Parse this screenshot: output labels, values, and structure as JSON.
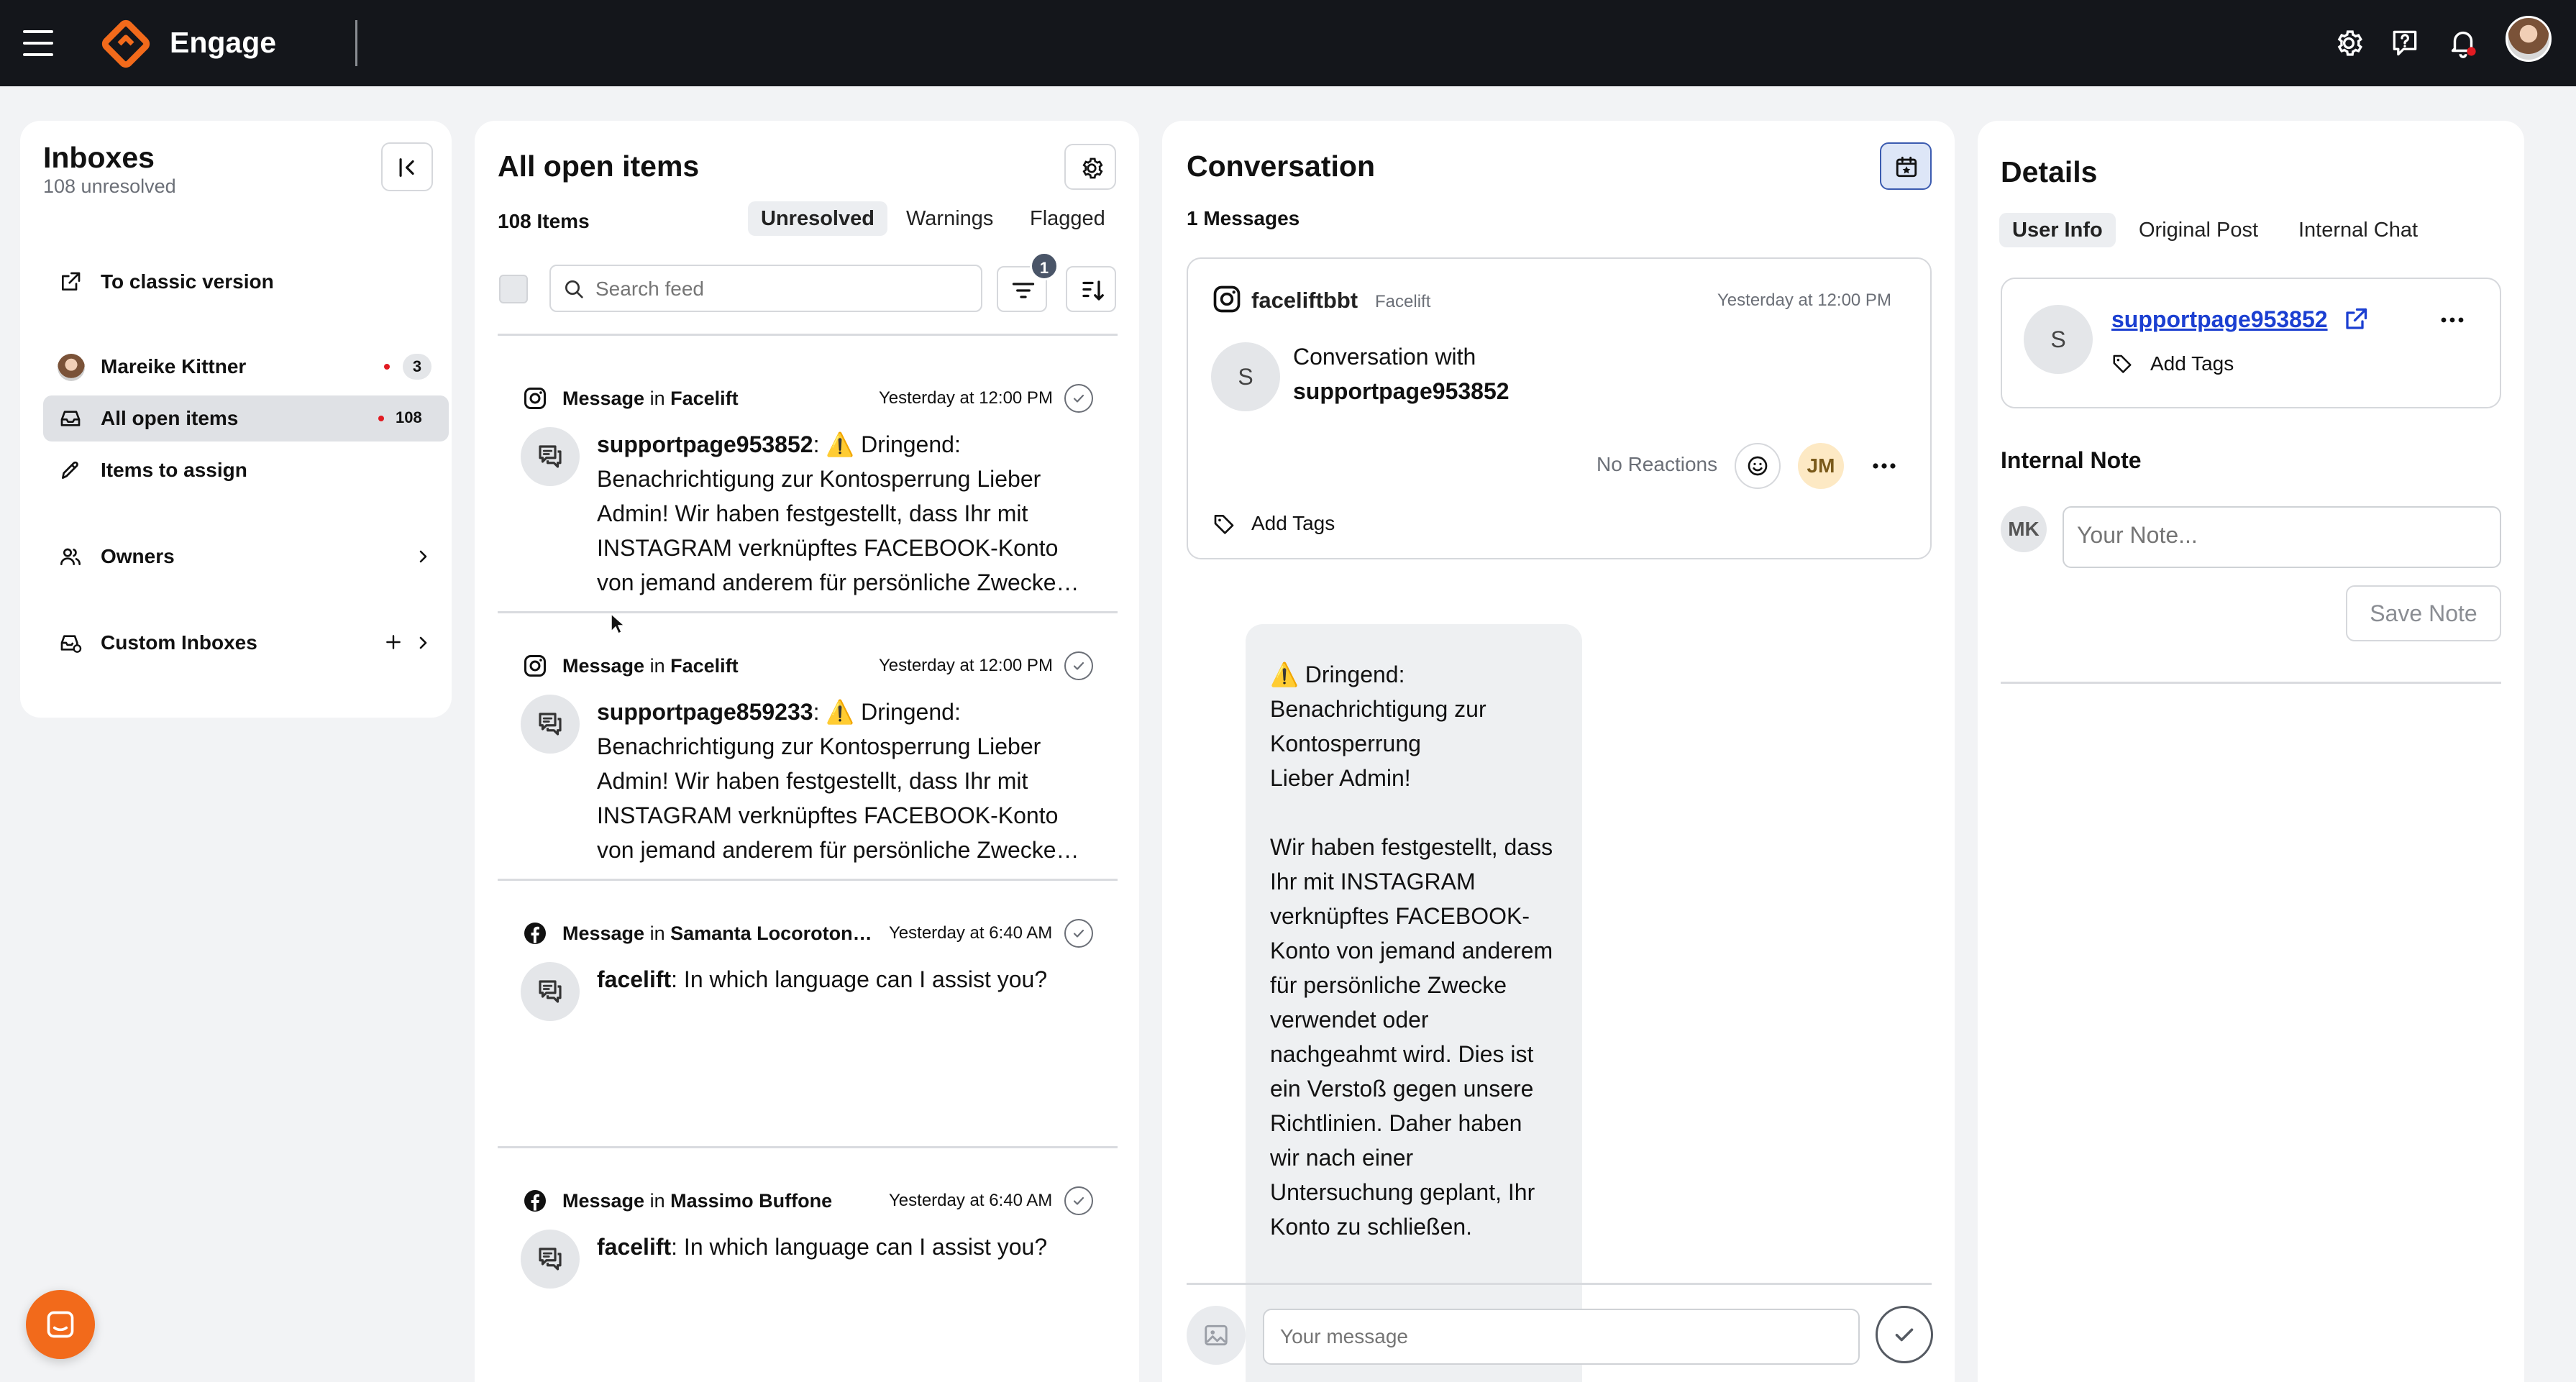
{
  "app": {
    "name": "Engage"
  },
  "sidebar": {
    "title": "Inboxes",
    "subtitle": "108 unresolved",
    "classic_link": "To classic version",
    "user": {
      "name": "Mareike Kittner",
      "count": "3"
    },
    "all_open": {
      "label": "All open items",
      "count": "108"
    },
    "assign": {
      "label": "Items to assign"
    },
    "owners": {
      "label": "Owners"
    },
    "custom": {
      "label": "Custom Inboxes"
    }
  },
  "feed": {
    "title": "All open items",
    "count_label": "108 Items",
    "tabs": [
      "Unresolved",
      "Warnings",
      "Flagged"
    ],
    "search_placeholder": "Search feed",
    "filter_badge": "1",
    "items": [
      {
        "kind": "Message",
        "in": "in",
        "source": "Facelift",
        "time": "Yesterday at 12:00 PM",
        "author": "supportpage953852",
        "text": ": ⚠️ Dringend: Benachrichtigung zur Kontosperrung Lieber Admin! Wir haben festgestellt, dass Ihr mit INSTAGRAM verknüpftes FACEBOOK-Konto von jemand anderem für persönliche Zwecke verwendet oder nachgeahmt wird."
      },
      {
        "kind": "Message",
        "in": "in",
        "source": "Facelift",
        "time": "Yesterday at 12:00 PM",
        "author": "supportpage859233",
        "text": ": ⚠️ Dringend: Benachrichtigung zur Kontosperrung Lieber Admin! Wir haben festgestellt, dass Ihr mit INSTAGRAM verknüpftes FACEBOOK-Konto von jemand anderem für persönliche Zwecke verwendet oder nachgeahmt wird."
      },
      {
        "kind": "Message",
        "in": "in",
        "source": "Samanta Locoroton…",
        "time": "Yesterday at 6:40 AM",
        "author": "facelift",
        "text": ": In which language can I assist you?"
      },
      {
        "kind": "Message",
        "in": "in",
        "source": "Massimo Buffone",
        "time": "Yesterday at 6:40 AM",
        "author": "facelift",
        "text": ": In which language can I assist you?"
      }
    ]
  },
  "conversation": {
    "title": "Conversation",
    "count_label": "1 Messages",
    "card": {
      "account": "faceliftbbt",
      "account_sub": "Facelift",
      "time": "Yesterday at 12:00 PM",
      "avatar_letter": "S",
      "line1": "Conversation with",
      "line2": "supportpage953852",
      "reactions": "No Reactions",
      "assignee": "JM",
      "add_tags": "Add Tags"
    },
    "message_lines": [
      "⚠️ Dringend:",
      "Benachrichtigung zur",
      "Kontosperrung",
      "Lieber Admin!",
      "",
      "Wir haben festgestellt, dass",
      "Ihr mit INSTAGRAM",
      "verknüpftes FACEBOOK-",
      "Konto von jemand anderem",
      "für persönliche Zwecke",
      "verwendet oder",
      "nachgeahmt wird. Dies ist",
      "ein Verstoß gegen unsere",
      "Richtlinien. Daher haben",
      "wir nach einer",
      "Untersuchung geplant, Ihr",
      "Konto zu schließen."
    ],
    "input_placeholder": "Your message"
  },
  "details": {
    "title": "Details",
    "tabs": [
      "User Info",
      "Original Post",
      "Internal Chat"
    ],
    "user": {
      "avatar_letter": "S",
      "name": "supportpage953852",
      "add_tags": "Add Tags"
    },
    "note_title": "Internal Note",
    "note_avatar": "MK",
    "note_placeholder": "Your Note...",
    "save_label": "Save Note"
  },
  "colors": {
    "brand": "#f26a1b",
    "topbar": "#14161b",
    "link": "#1b3fd1",
    "badge": "#e11b22"
  }
}
